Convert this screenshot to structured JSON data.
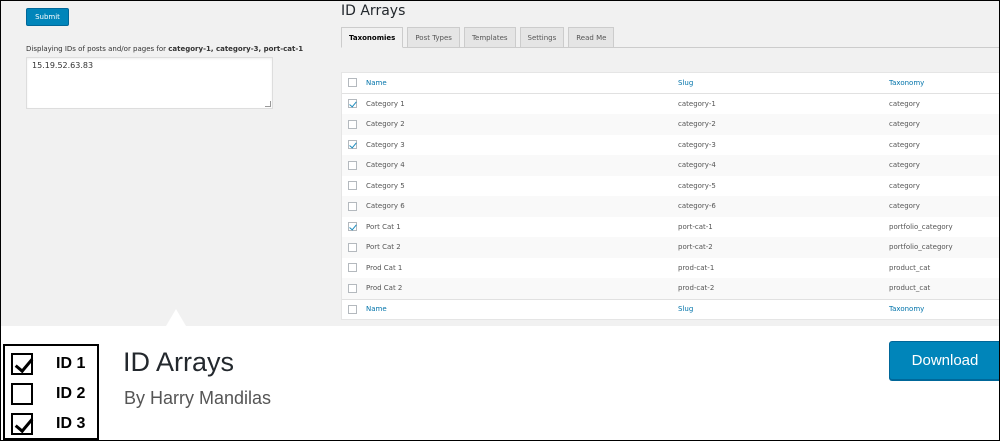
{
  "left_panel": {
    "submit_label": "Submit",
    "display_prefix": "Displaying IDs of posts and/or pages for ",
    "display_terms": "category-1, category-3, port-cat-1",
    "ids_value": "15.19.52.63.83"
  },
  "main": {
    "heading": "ID Arrays",
    "tabs": [
      {
        "label": "Taxonomies",
        "active": true
      },
      {
        "label": "Post Types",
        "active": false
      },
      {
        "label": "Templates",
        "active": false
      },
      {
        "label": "Settings",
        "active": false
      },
      {
        "label": "Read Me",
        "active": false
      }
    ],
    "table": {
      "columns": {
        "name": "Name",
        "slug": "Slug",
        "taxonomy": "Taxonomy"
      },
      "rows": [
        {
          "name": "Category 1",
          "slug": "category-1",
          "taxonomy": "category",
          "checked": true
        },
        {
          "name": "Category 2",
          "slug": "category-2",
          "taxonomy": "category",
          "checked": false
        },
        {
          "name": "Category 3",
          "slug": "category-3",
          "taxonomy": "category",
          "checked": true
        },
        {
          "name": "Category 4",
          "slug": "category-4",
          "taxonomy": "category",
          "checked": false
        },
        {
          "name": "Category 5",
          "slug": "category-5",
          "taxonomy": "category",
          "checked": false
        },
        {
          "name": "Category 6",
          "slug": "category-6",
          "taxonomy": "category",
          "checked": false
        },
        {
          "name": "Port Cat 1",
          "slug": "port-cat-1",
          "taxonomy": "portfolio_category",
          "checked": true
        },
        {
          "name": "Port Cat 2",
          "slug": "port-cat-2",
          "taxonomy": "portfolio_category",
          "checked": false
        },
        {
          "name": "Prod Cat 1",
          "slug": "prod-cat-1",
          "taxonomy": "product_cat",
          "checked": false
        },
        {
          "name": "Prod Cat 2",
          "slug": "prod-cat-2",
          "taxonomy": "product_cat",
          "checked": false
        }
      ]
    }
  },
  "plugin": {
    "logo_items": [
      {
        "label": "ID 1",
        "checked": true
      },
      {
        "label": "ID 2",
        "checked": false
      },
      {
        "label": "ID 3",
        "checked": true
      }
    ],
    "title": "ID Arrays",
    "author": "By Harry Mandilas",
    "download_label": "Download"
  },
  "colors": {
    "accent": "#0085ba",
    "link": "#0073aa",
    "checkmark": "#1e8cbe"
  }
}
